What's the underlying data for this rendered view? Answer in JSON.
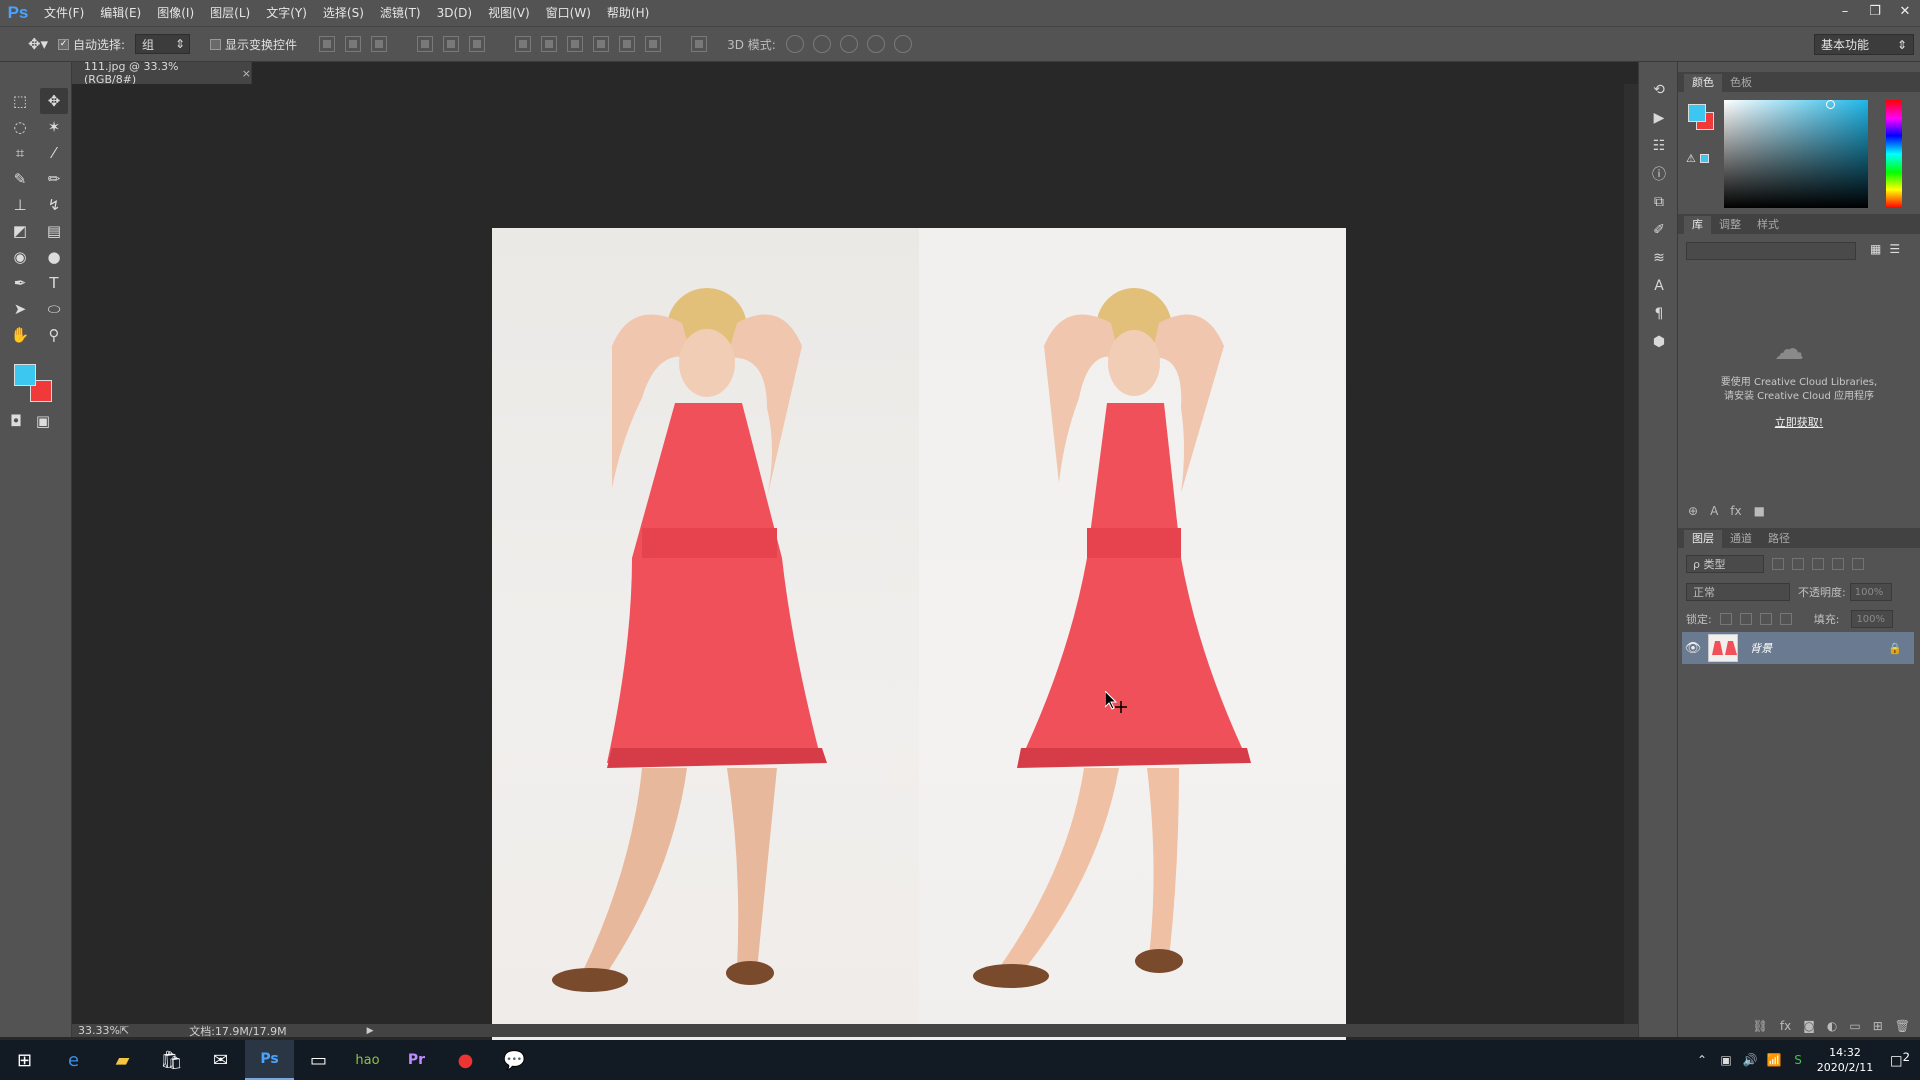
{
  "app": {
    "logo": "Ps",
    "menu": [
      "文件(F)",
      "编辑(E)",
      "图像(I)",
      "图层(L)",
      "文字(Y)",
      "选择(S)",
      "滤镜(T)",
      "3D(D)",
      "视图(V)",
      "窗口(W)",
      "帮助(H)"
    ],
    "window_controls": [
      "minimize-icon",
      "restore-icon",
      "close-icon"
    ]
  },
  "options_bar": {
    "auto_select_label": "自动选择:",
    "auto_select_value": "组",
    "show_transform_label": "显示变换控件",
    "mode_3d_label": "3D 模式:",
    "workspace": "基本功能"
  },
  "document": {
    "tab_title": "111.jpg @ 33.3%(RGB/8#)",
    "tab_close": "×"
  },
  "status": {
    "zoom": "33.33%",
    "doc_size": "文档:17.9M/17.9M",
    "arrow": "▶"
  },
  "panels": {
    "color_tabs": [
      "颜色",
      "色板"
    ],
    "library_tabs": [
      "库",
      "调整",
      "样式"
    ],
    "library_message_line1": "要使用 Creative Cloud Libraries,",
    "library_message_line2": "请安装 Creative Cloud 应用程序",
    "library_link": "立即获取!",
    "layers_tabs": [
      "图层",
      "通道",
      "路径"
    ],
    "filter_kind": "ρ 类型",
    "blend_mode": "正常",
    "opacity_label": "不透明度:",
    "opacity_value": "100%",
    "lock_label": "锁定:",
    "fill_label": "填充:",
    "fill_value": "100%",
    "layer_name": "背景"
  },
  "colors": {
    "foreground": "#3cc7f0",
    "background": "#f03a3a",
    "dress": "#f0505a"
  },
  "taskbar": {
    "clock_time": "14:32",
    "clock_date": "2020/2/11",
    "notifications": "2"
  }
}
